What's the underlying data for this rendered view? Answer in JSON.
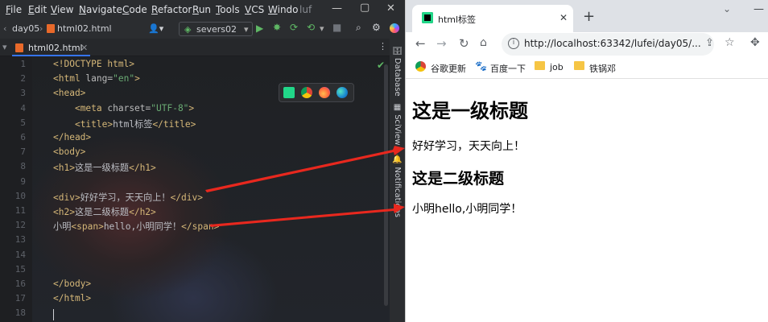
{
  "ide": {
    "menu": [
      {
        "label": "File",
        "u": "F",
        "rest": "ile"
      },
      {
        "label": "Edit",
        "u": "E",
        "rest": "dit"
      },
      {
        "label": "View",
        "u": "V",
        "rest": "iew"
      },
      {
        "label": "Navigate",
        "u": "N",
        "rest": "avigate"
      },
      {
        "label": "Code",
        "u": "C",
        "rest": "ode"
      },
      {
        "label": "Refactor",
        "u": "R",
        "rest": "efactor"
      },
      {
        "label": "Run",
        "u": "R",
        "rest": "un"
      },
      {
        "label": "Tools",
        "u": "T",
        "rest": "ools"
      },
      {
        "label": "VCS",
        "u": "V",
        "rest": "CS"
      },
      {
        "label": "Windo",
        "u": "W",
        "rest": "indo"
      },
      {
        "label": "luf",
        "u": "",
        "rest": "luf"
      }
    ],
    "breadcrumb": {
      "project": "day05",
      "file": "html02.html"
    },
    "run_config": "severs02",
    "editor_tab": "html02.html",
    "right_tools": [
      "Database",
      "SciView",
      "Notifications"
    ],
    "line_numbers": [
      "1",
      "2",
      "3",
      "4",
      "5",
      "6",
      "7",
      "8",
      "9",
      "10",
      "11",
      "12",
      "13",
      "14",
      "15",
      "16",
      "17",
      "18"
    ],
    "code_lines": [
      [
        {
          "t": "tg",
          "v": "<!DOCTYPE html>"
        }
      ],
      [
        {
          "t": "tg",
          "v": "<html "
        },
        {
          "t": "at",
          "v": "lang="
        },
        {
          "t": "av",
          "v": "\"en\""
        },
        {
          "t": "tg",
          "v": ">"
        }
      ],
      [
        {
          "t": "tg",
          "v": "<head>"
        }
      ],
      [
        {
          "t": "tx",
          "v": "    "
        },
        {
          "t": "tg",
          "v": "<meta "
        },
        {
          "t": "at",
          "v": "charset="
        },
        {
          "t": "av",
          "v": "\"UTF-8\""
        },
        {
          "t": "tg",
          "v": ">"
        }
      ],
      [
        {
          "t": "tx",
          "v": "    "
        },
        {
          "t": "tg",
          "v": "<title>"
        },
        {
          "t": "tx",
          "v": "html标签"
        },
        {
          "t": "tg",
          "v": "</title>"
        }
      ],
      [
        {
          "t": "tg",
          "v": "</head>"
        }
      ],
      [
        {
          "t": "tg",
          "v": "<body>"
        }
      ],
      [
        {
          "t": "tg",
          "v": "<h1>"
        },
        {
          "t": "tx",
          "v": "这是一级标题"
        },
        {
          "t": "tg",
          "v": "</h1>"
        }
      ],
      [],
      [
        {
          "t": "tg",
          "v": "<div>"
        },
        {
          "t": "tx",
          "v": "好好学习，天天向上！"
        },
        {
          "t": "tg",
          "v": "</div>"
        }
      ],
      [
        {
          "t": "tg",
          "v": "<h2>"
        },
        {
          "t": "tx",
          "v": "这是二级标题"
        },
        {
          "t": "tg",
          "v": "</h2>"
        }
      ],
      [
        {
          "t": "tx",
          "v": "小明"
        },
        {
          "t": "tg",
          "v": "<span>"
        },
        {
          "t": "tx",
          "v": "hello,小明同学！"
        },
        {
          "t": "tg",
          "v": "</span>"
        }
      ],
      [],
      [],
      [],
      [
        {
          "t": "tg",
          "v": "</body>"
        }
      ],
      [
        {
          "t": "tg",
          "v": "</html>"
        }
      ],
      []
    ],
    "colors": {
      "tag": "#d5b778",
      "attr": "#bababa",
      "value": "#6aab73",
      "text": "#bcbec4"
    }
  },
  "browser": {
    "tab_title": "html标签",
    "url": "http://localhost:63342/lufei/day05/...",
    "bookmarks": [
      "谷歌更新",
      "百度一下",
      "job",
      "铁锅邓"
    ],
    "page": {
      "h1": "这是一级标题",
      "div": "好好学习，天天向上！",
      "h2": "这是二级标题",
      "span_line": "小明hello,小明同学！"
    }
  },
  "annotation_color": "#e8281e"
}
